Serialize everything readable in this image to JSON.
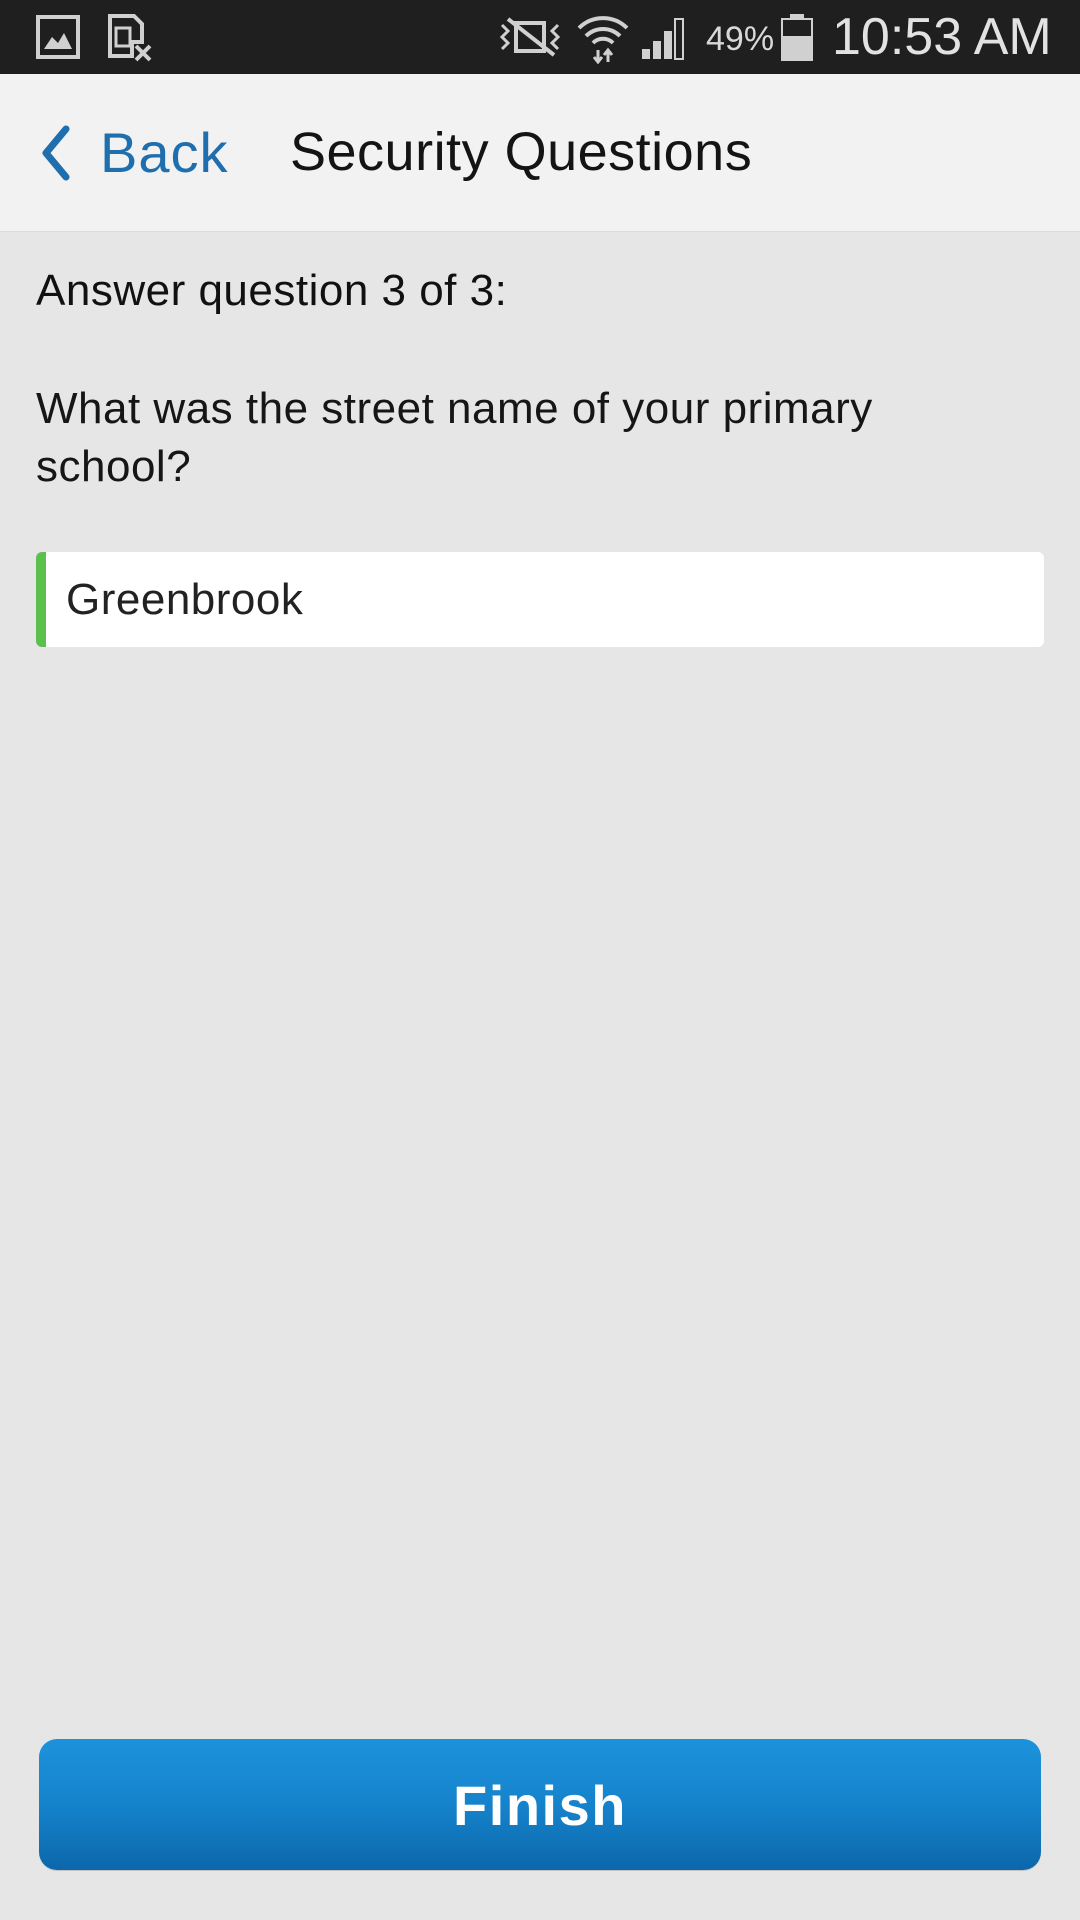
{
  "status_bar": {
    "battery_percent": "49%",
    "time": "10:53 AM",
    "icons": [
      "gallery-icon",
      "sim-card-icon",
      "vibrate-mute-icon",
      "wifi-icon",
      "cell-signal-icon",
      "battery-icon"
    ]
  },
  "header": {
    "back_label": "Back",
    "title": "Security Questions"
  },
  "form": {
    "prompt": "Answer question 3 of 3:",
    "question": "What was the street name of your primary school?",
    "answer_value": "Greenbrook"
  },
  "footer": {
    "finish_label": "Finish"
  },
  "colors": {
    "accent_link": "#1f6eae",
    "valid_indicator": "#5cc04f",
    "button_top": "#1d92dc",
    "button_bottom": "#0c67aa",
    "background": "#e6e6e7",
    "header_background": "#f2f2f2"
  }
}
